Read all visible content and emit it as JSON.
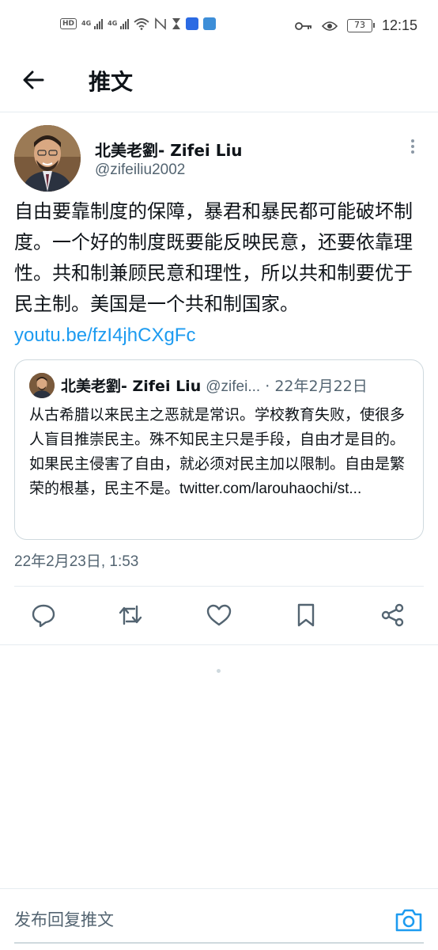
{
  "status_bar": {
    "hd": "HD",
    "network1": "4G",
    "network2": "4G",
    "battery": "73",
    "time": "12:15"
  },
  "header": {
    "title": "推文",
    "back_icon": "arrow-left-icon"
  },
  "tweet": {
    "author_name": "北美老劉- Zifei Liu",
    "author_handle": "@zifeiliu2002",
    "text": "自由要靠制度的保障，暴君和暴民都可能破坏制度。一个好的制度既要能反映民意，还要依靠理性。共和制兼顾民意和理性，所以共和制要优于民主制。美国是一个共和制国家。",
    "link": "youtu.be/fzI4jhCXgFc",
    "timestamp": "22年2月23日, 1:53",
    "quoted": {
      "author_name": "北美老劉- Zifei Liu",
      "author_handle": "@zifei...",
      "date": "· 22年2月22日",
      "text": "从古希腊以来民主之恶就是常识。学校教育失败，使很多人盲目推崇民主。殊不知民主只是手段，自由才是目的。如果民主侵害了自由，就必须对民主加以限制。自由是繁荣的根基，民主不是。",
      "link": "twitter.com/larouhaochi/st..."
    }
  },
  "actions": [
    "reply-icon",
    "retweet-icon",
    "like-icon",
    "bookmark-icon",
    "share-icon"
  ],
  "reply_bar": {
    "placeholder": "发布回复推文"
  },
  "colors": {
    "accent": "#1d9bf0",
    "text": "#0f1419",
    "secondary": "#536471",
    "border": "#cfd9de"
  }
}
